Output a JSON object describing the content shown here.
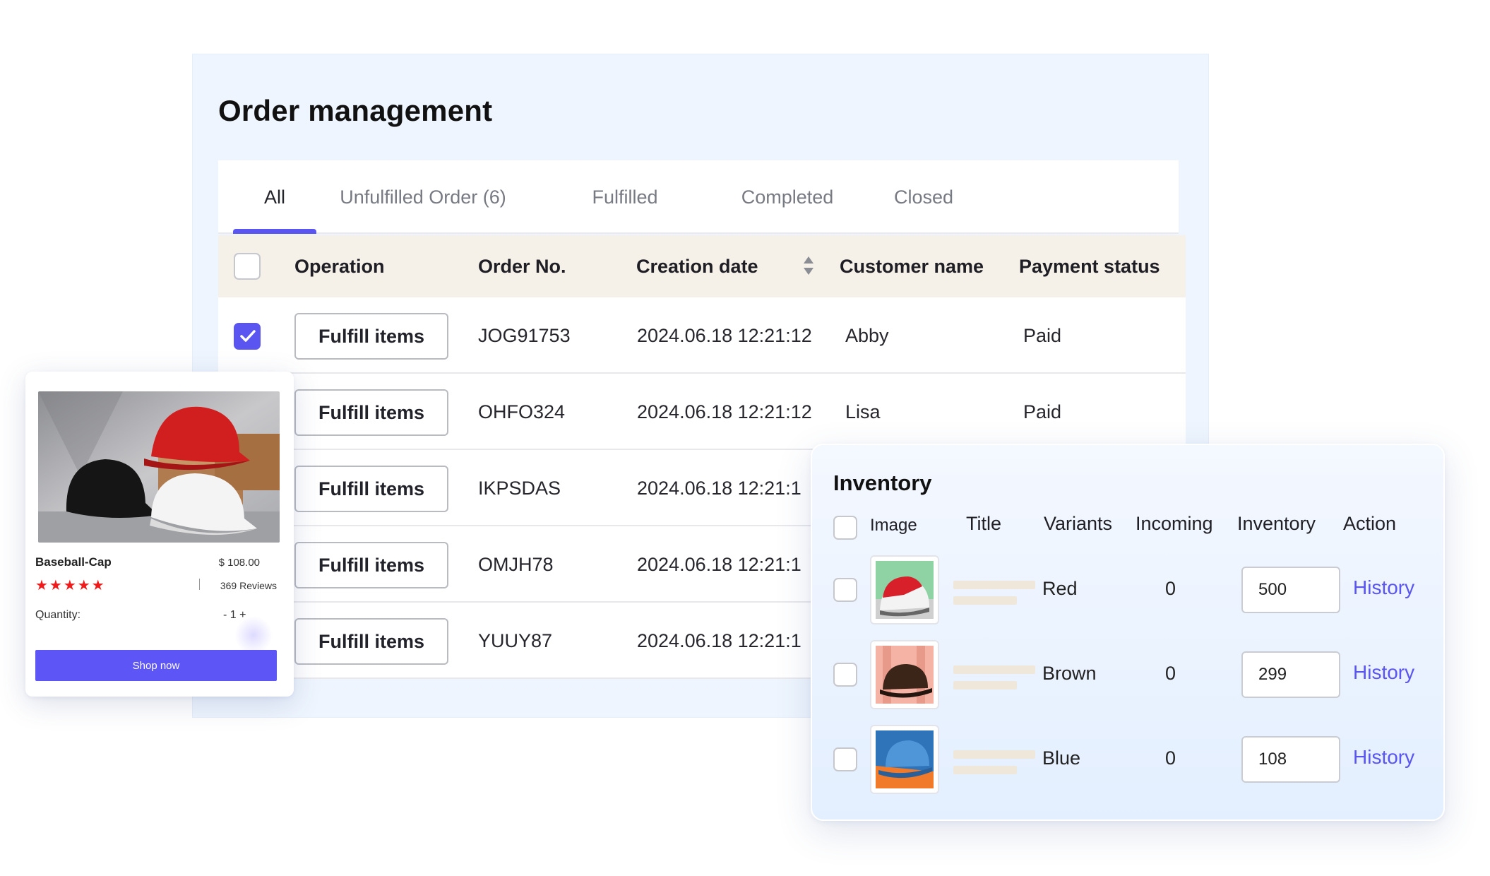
{
  "order": {
    "title": "Order management",
    "tabs": [
      {
        "label": "All",
        "active": true
      },
      {
        "label": "Unfulfilled Order (6)",
        "active": false
      },
      {
        "label": "Fulfilled",
        "active": false
      },
      {
        "label": "Completed",
        "active": false
      },
      {
        "label": "Closed",
        "active": false
      }
    ],
    "columns": [
      "Operation",
      "Order No.",
      "Creation date",
      "Customer name",
      "Payment status"
    ],
    "rows": [
      {
        "selected": true,
        "action": "Fulfill items",
        "order_no": "JOG91753",
        "date": "2024.06.18 12:21:12",
        "customer": "Abby",
        "payment": "Paid"
      },
      {
        "selected": false,
        "action": "Fulfill items",
        "order_no": "OHFO324",
        "date": "2024.06.18 12:21:12",
        "customer": "Lisa",
        "payment": "Paid"
      },
      {
        "selected": false,
        "action": "Fulfill items",
        "order_no": "IKPSDAS",
        "date": "2024.06.18 12:21:1",
        "customer": "",
        "payment": ""
      },
      {
        "selected": false,
        "action": "Fulfill items",
        "order_no": "OMJH78",
        "date": "2024.06.18 12:21:1",
        "customer": "",
        "payment": ""
      },
      {
        "selected": false,
        "action": "Fulfill items",
        "order_no": "YUUY87",
        "date": "2024.06.18 12:21:1",
        "customer": "",
        "payment": ""
      }
    ],
    "accent_color": "#5a55f0",
    "header_bg": "#f5f0e8"
  },
  "product": {
    "name": "Baseball-Cap",
    "price": "$ 108.00",
    "stars": "★★★★★",
    "reviews": "369 Reviews",
    "quantity_label": "Quantity:",
    "quantity": "- 1 +",
    "button": "Shop now",
    "star_color": "#ef1a1a"
  },
  "inventory": {
    "title": "Inventory",
    "columns": {
      "image": "Image",
      "title": "Title",
      "variants": "Variants",
      "incoming": "Incoming",
      "inventory": "Inventory",
      "action": "Action"
    },
    "rows": [
      {
        "variant": "Red",
        "incoming": "0",
        "inventory": "500",
        "action": "History",
        "thumb_icon": "red-cap"
      },
      {
        "variant": "Brown",
        "incoming": "0",
        "inventory": "299",
        "action": "History",
        "thumb_icon": "brown-cap"
      },
      {
        "variant": "Blue",
        "incoming": "0",
        "inventory": "108",
        "action": "History",
        "thumb_icon": "blue-cap"
      }
    ]
  }
}
